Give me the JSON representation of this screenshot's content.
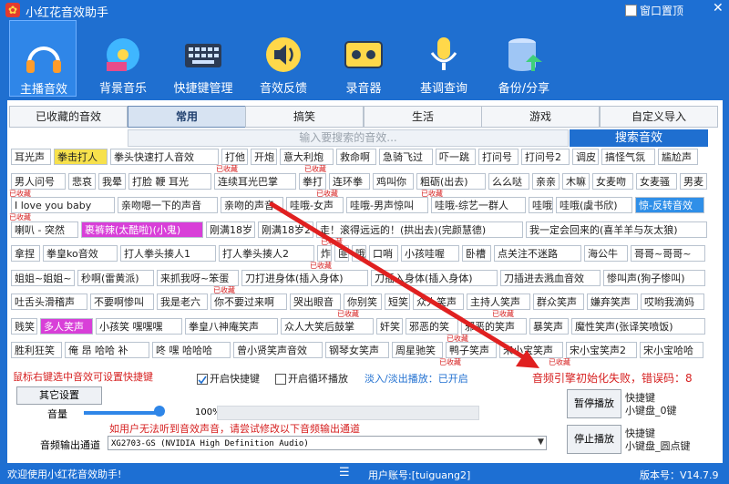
{
  "window": {
    "title": "小红花音效助手",
    "pin_label": "窗口置顶",
    "close": "✕"
  },
  "toolbar": [
    {
      "label": "主播音效",
      "icon": "headphones-icon",
      "active": true
    },
    {
      "label": "背景音乐",
      "icon": "music-disc-icon"
    },
    {
      "label": "快捷键管理",
      "icon": "keyboard-icon"
    },
    {
      "label": "音效反馈",
      "icon": "speaker-icon"
    },
    {
      "label": "录音器",
      "icon": "cassette-icon"
    },
    {
      "label": "基调查询",
      "icon": "microphone-icon"
    },
    {
      "label": "备份/分享",
      "icon": "database-icon"
    }
  ],
  "categories": [
    "已收藏的音效",
    "常用",
    "搞笑",
    "生活",
    "游戏",
    "自定义导入"
  ],
  "search": {
    "placeholder": "输入要搜索的音效...",
    "button": "搜索音效"
  },
  "collected_tag": "已收藏",
  "sounds": [
    [
      {
        "t": "耳光声"
      },
      {
        "t": "拳击打人",
        "s": "yel"
      },
      {
        "t": "拳头快速打人音效"
      },
      {
        "t": "打他"
      },
      {
        "t": "开炮"
      },
      {
        "t": "意大利炮"
      },
      {
        "t": "救命啊"
      },
      {
        "t": "急骑飞过"
      },
      {
        "t": "吓一跳"
      },
      {
        "t": "打问号"
      },
      {
        "t": "打问号2"
      },
      {
        "t": "调皮"
      },
      {
        "t": "搞怪气氛"
      },
      {
        "t": "尴尬声"
      }
    ],
    [
      {
        "t": "男人问号"
      },
      {
        "t": "悲哀"
      },
      {
        "t": "我晕"
      },
      {
        "t": "打脸 鞭 耳光"
      },
      {
        "t": "连续耳光巴掌"
      },
      {
        "t": "拳打"
      },
      {
        "t": "连环拳"
      },
      {
        "t": "鸡叫你"
      },
      {
        "t": "粗砺(出去)"
      },
      {
        "t": "么么哒"
      },
      {
        "t": "亲亲"
      },
      {
        "t": "木嘛"
      },
      {
        "t": "女麦吻"
      },
      {
        "t": "女麦骚"
      },
      {
        "t": "男麦"
      }
    ],
    [
      {
        "t": "I love you baby"
      },
      {
        "t": "亲吻嗯一下的声音"
      },
      {
        "t": "亲吻的声音"
      },
      {
        "t": "哇哦-女声"
      },
      {
        "t": "哇哦-男声惊叫"
      },
      {
        "t": "哇哦-综艺一群人"
      },
      {
        "t": "哇哦"
      },
      {
        "t": "哇哦(虞书欣)"
      },
      {
        "t": "惊-反转音效",
        "s": "blue"
      }
    ],
    [
      {
        "t": "喇叭 - 突然"
      },
      {
        "t": "裹裤辣(太酷啦)(小鬼)",
        "s": "pink"
      },
      {
        "t": "刚满18岁"
      },
      {
        "t": "刚满18岁2"
      },
      {
        "t": "走！滚得远远的！(拱出去)(完颜慧德)"
      },
      {
        "t": "我一定会回来的(喜羊羊与灰太狼)"
      }
    ],
    [
      {
        "t": "拿捏"
      },
      {
        "t": "拳皇ko音效"
      },
      {
        "t": "打人拳头揍人1"
      },
      {
        "t": "打人拳头揍人2"
      },
      {
        "t": "炸"
      },
      {
        "t": "匪"
      },
      {
        "t": "哦"
      },
      {
        "t": "口哨"
      },
      {
        "t": "小孩哇喔"
      },
      {
        "t": "卧槽"
      },
      {
        "t": "点关注不迷路"
      },
      {
        "t": "海公牛"
      },
      {
        "t": "哥哥~哥哥~"
      }
    ],
    [
      {
        "t": "姐姐~姐姐~"
      },
      {
        "t": "秒啊(雷黄派)"
      },
      {
        "t": "来抓我呀~笨蛋"
      },
      {
        "t": "刀打进身体(插入身体)"
      },
      {
        "t": "刀插入身体(插入身体)"
      },
      {
        "t": "刀插进去溅血音效"
      },
      {
        "t": "惨叫声(狗子惨叫)"
      }
    ],
    [
      {
        "t": "吐舌头滑稽声"
      },
      {
        "t": "不要啊惨叫"
      },
      {
        "t": "我是老六"
      },
      {
        "t": "你不要过来啊"
      },
      {
        "t": "哭出眼音"
      },
      {
        "t": "你别笑"
      },
      {
        "t": "短笑"
      },
      {
        "t": "众人笑声"
      },
      {
        "t": "主持人笑声"
      },
      {
        "t": "群众笑声"
      },
      {
        "t": "嫌弃笑声"
      },
      {
        "t": "哎哟我滴妈"
      }
    ],
    [
      {
        "t": "贱笑"
      },
      {
        "t": "多人笑声",
        "s": "pink"
      },
      {
        "t": "小孩笑 嘿嘿嘿"
      },
      {
        "t": "拳皇八神庵笑声"
      },
      {
        "t": "众人大笑后鼓掌"
      },
      {
        "t": "奸笑"
      },
      {
        "t": "邪恶的笑"
      },
      {
        "t": "邪恶的笑声"
      },
      {
        "t": "暴笑声"
      },
      {
        "t": "魔性笑声(张译笑喷饭)"
      }
    ],
    [
      {
        "t": "胜利狂笑"
      },
      {
        "t": "俺 昂 哈哈 补"
      },
      {
        "t": "咚 嘿 哈哈哈"
      },
      {
        "t": "曾小贤笑声音效"
      },
      {
        "t": "钢琴女笑声"
      },
      {
        "t": "周星驰笑"
      },
      {
        "t": "鸭子笑声"
      },
      {
        "t": "宋小宝笑声"
      },
      {
        "t": "宋小宝笑声2"
      },
      {
        "t": "宋小宝哈哈"
      }
    ]
  ],
  "settings": {
    "hint": "鼠标右键选中音效可设置快捷键",
    "hotkey_label": "开启快捷键",
    "loop_label": "开启循环播放",
    "fade_label": "淡入/淡出播放：已开启",
    "error": "音频引擎初始化失败，错误码：8",
    "other_settings": "其它设置",
    "volume_label": "音量",
    "volume_value": "100%",
    "volume": 1.0,
    "output_hint": "如用户无法听到音效声音，请尝试修改以下音频输出通道",
    "output_label": "音频输出通道",
    "output_device": "XG2703-GS (NVIDIA High Definition Audio)",
    "pause_button": "暂停播放",
    "pause_hotkey_1": "快捷键",
    "pause_hotkey_2": "小键盘_0键",
    "stop_button": "停止播放",
    "stop_hotkey_1": "快捷键",
    "stop_hotkey_2": "小键盘_圆点键"
  },
  "status": {
    "left": "欢迎使用小红花音效助手!",
    "user": "用户账号:[tuiguang2]",
    "version": "版本号：V14.7.9"
  },
  "colors": {
    "brand": "#1f6fd0",
    "error": "#d62020",
    "highlight_yellow": "#f7e14c",
    "highlight_pink": "#d83fd8",
    "arrow": "#e02020"
  }
}
